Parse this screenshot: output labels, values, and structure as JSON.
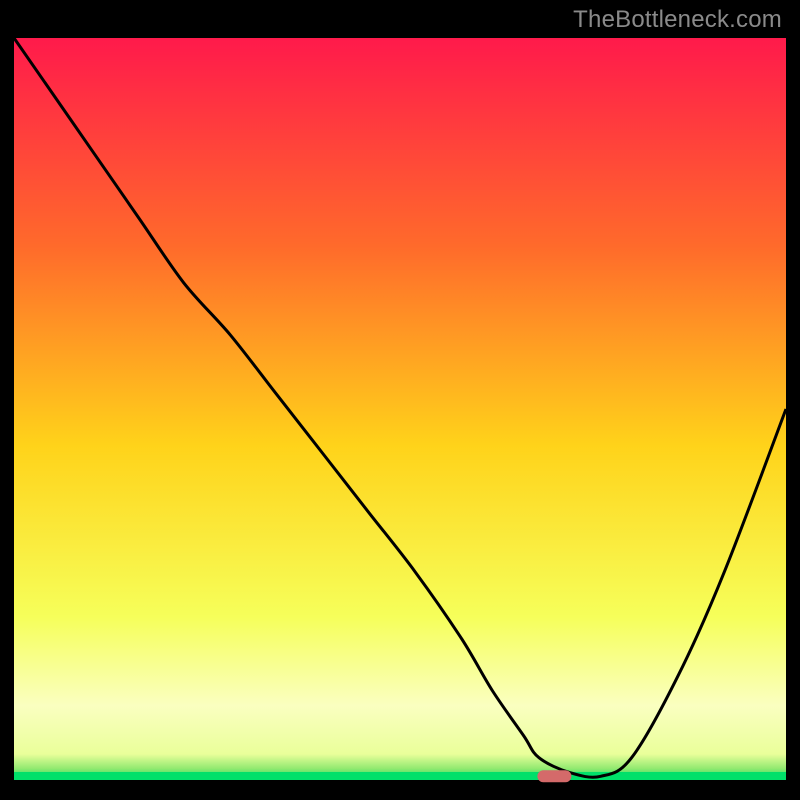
{
  "watermark": "TheBottleneck.com",
  "colors": {
    "top": "#ff1a4b",
    "mid_upper": "#ff8a2b",
    "mid": "#ffd31a",
    "mid_lower": "#f6ff5a",
    "band_pale": "#faffc0",
    "green": "#00e06a",
    "curve": "#000000",
    "marker": "#d46a6a"
  },
  "chart_data": {
    "type": "line",
    "title": "",
    "xlabel": "",
    "ylabel": "",
    "xlim": [
      0,
      100
    ],
    "ylim": [
      0,
      100
    ],
    "x": [
      0,
      4,
      10,
      16,
      22,
      28,
      34,
      40,
      46,
      52,
      58,
      62,
      66,
      68,
      72,
      76,
      80,
      86,
      92,
      100
    ],
    "values": [
      100,
      94,
      85,
      76,
      67,
      60,
      52,
      44,
      36,
      28,
      19,
      12,
      6,
      3,
      1,
      0.5,
      3,
      14,
      28,
      50
    ],
    "series": [
      {
        "name": "bottleneck-curve",
        "x": [
          0,
          4,
          10,
          16,
          22,
          28,
          34,
          40,
          46,
          52,
          58,
          62,
          66,
          68,
          72,
          76,
          80,
          86,
          92,
          100
        ],
        "values": [
          100,
          94,
          85,
          76,
          67,
          60,
          52,
          44,
          36,
          28,
          19,
          12,
          6,
          3,
          1,
          0.5,
          3,
          14,
          28,
          50
        ]
      }
    ],
    "marker": {
      "x": 70,
      "y": 0.5,
      "label": ""
    },
    "gradient_bands": [
      {
        "stop": 0.0,
        "color": "#ff1a4b"
      },
      {
        "stop": 0.28,
        "color": "#ff6a2b"
      },
      {
        "stop": 0.55,
        "color": "#ffd31a"
      },
      {
        "stop": 0.78,
        "color": "#f6ff5a"
      },
      {
        "stop": 0.9,
        "color": "#faffc0"
      },
      {
        "stop": 0.965,
        "color": "#eaff9a"
      },
      {
        "stop": 0.985,
        "color": "#8fe96f"
      },
      {
        "stop": 1.0,
        "color": "#00e06a"
      }
    ]
  }
}
